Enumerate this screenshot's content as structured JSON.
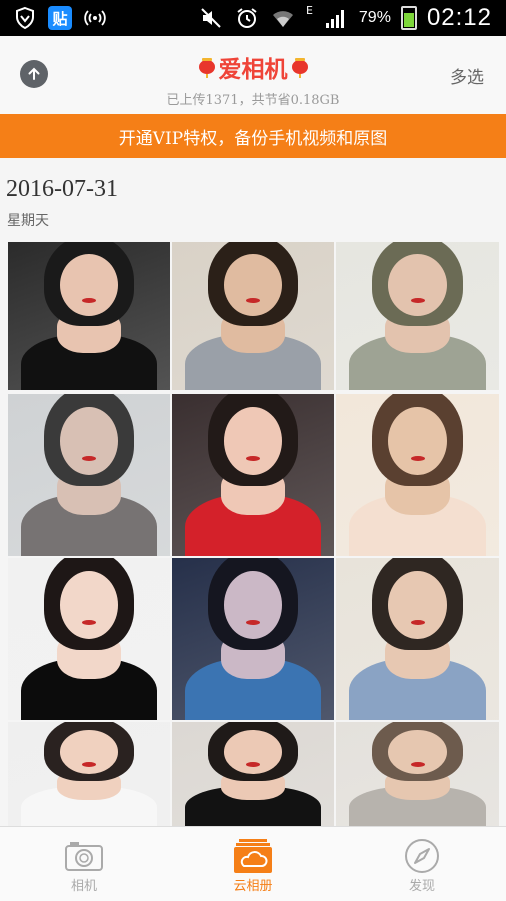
{
  "status_bar": {
    "tieba_label": "贴",
    "network_type": "E",
    "battery": "79%",
    "battery_level": 0.79,
    "time": "02:12"
  },
  "header": {
    "title": "爱相机",
    "subtitle": "已上传1371，共节省0.18GB",
    "multi_select": "多选"
  },
  "banner": {
    "text": "开通VIP特权，备份手机视频和原图"
  },
  "album": {
    "date": "2016-07-31",
    "weekday": "星期天",
    "photos": [
      {
        "bg": "#2b2b2b",
        "skin": "#e8c4b0",
        "hair": "#1a1a1a",
        "outfit": "#111111"
      },
      {
        "bg": "#d9d2c7",
        "skin": "#e0bba0",
        "hair": "#2b2018",
        "outfit": "#9aa0a8"
      },
      {
        "bg": "#e6e6e0",
        "skin": "#e3c3ae",
        "hair": "#6b6b55",
        "outfit": "#9ea394"
      },
      {
        "bg": "#cfd2d4",
        "skin": "#d8c0b4",
        "hair": "#3a3a3a",
        "outfit": "#777373"
      },
      {
        "bg": "#3a2f30",
        "skin": "#efc8b6",
        "hair": "#221a18",
        "outfit": "#d4212a"
      },
      {
        "bg": "#f2e7da",
        "skin": "#e6c4a8",
        "hair": "#5a4030",
        "outfit": "#f4dfd0"
      },
      {
        "bg": "#f1f1f1",
        "skin": "#f2d7c9",
        "hair": "#1e1716",
        "outfit": "#0c0c0c"
      },
      {
        "bg": "#26304a",
        "skin": "#cbb8c6",
        "hair": "#151620",
        "outfit": "#3b74b2"
      },
      {
        "bg": "#e8e3da",
        "skin": "#e7c8b2",
        "hair": "#2f2722",
        "outfit": "#8aa3c4"
      },
      {
        "bg": "#efefef",
        "skin": "#f0d1bf",
        "hair": "#2a2220",
        "outfit": "#f7f7f7"
      },
      {
        "bg": "#dcd8d3",
        "skin": "#ecc9b5",
        "hair": "#1f1a18",
        "outfit": "#121212"
      },
      {
        "bg": "#e4e1dc",
        "skin": "#e6c7b0",
        "hair": "#6d5b4d",
        "outfit": "#b7b3ad"
      }
    ]
  },
  "bottom_nav": {
    "tabs": [
      {
        "label": "相机",
        "icon": "camera-icon",
        "active": false
      },
      {
        "label": "云相册",
        "icon": "cloud-album-icon",
        "active": true
      },
      {
        "label": "发现",
        "icon": "compass-icon",
        "active": false
      }
    ]
  },
  "colors": {
    "accent": "#f57f17",
    "title_red": "#ef4438",
    "battery_green": "#7dd63a"
  }
}
